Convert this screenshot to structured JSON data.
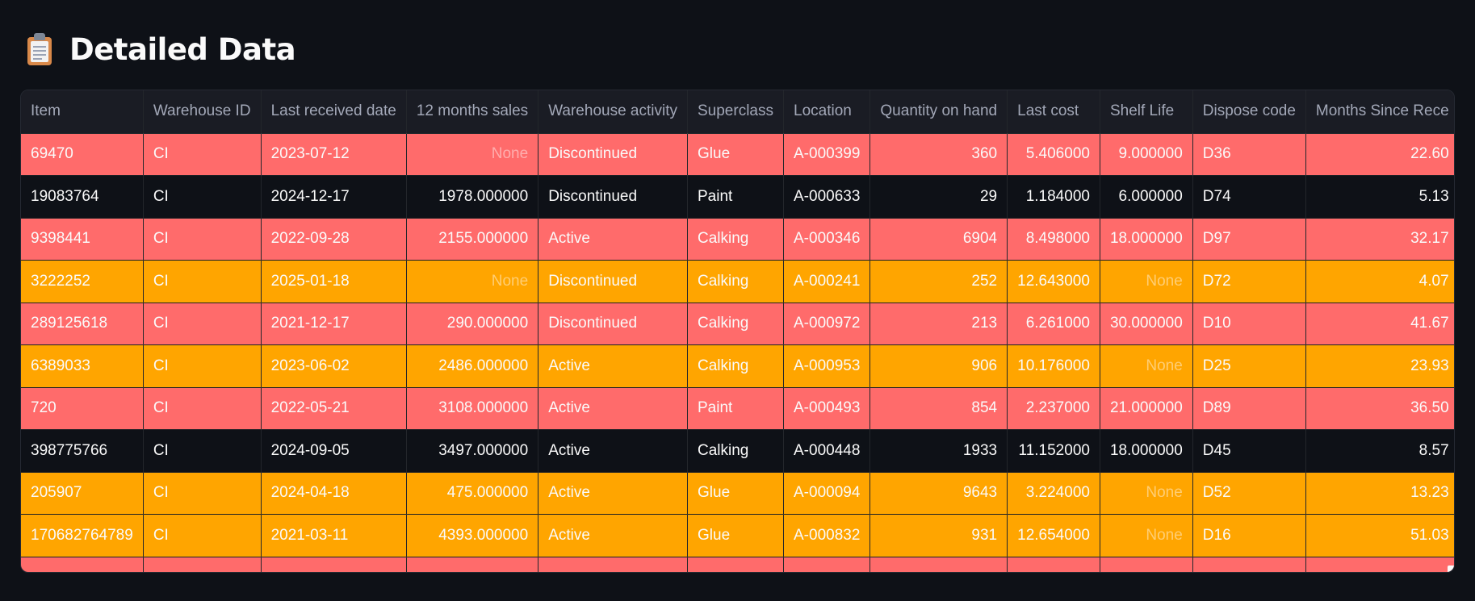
{
  "header": {
    "icon": "clipboard-icon",
    "title": "Detailed Data"
  },
  "table": {
    "columns": [
      "Item",
      "Warehouse ID",
      "Last received date",
      "12 months sales",
      "Warehouse activity",
      "Superclass",
      "Location",
      "Quantity on hand",
      "Last cost",
      "Shelf Life",
      "Dispose code",
      "Months Since Rece"
    ],
    "rows": [
      {
        "tone": "red",
        "cells": [
          "69470",
          "CI",
          "2023-07-12",
          "None",
          "Discontinued",
          "Glue",
          "A-000399",
          "360",
          "5.406000",
          "9.000000",
          "D36",
          "22.60"
        ]
      },
      {
        "tone": "plain",
        "cells": [
          "19083764",
          "CI",
          "2024-12-17",
          "1978.000000",
          "Discontinued",
          "Paint",
          "A-000633",
          "29",
          "1.184000",
          "6.000000",
          "D74",
          "5.13"
        ]
      },
      {
        "tone": "red",
        "cells": [
          "9398441",
          "CI",
          "2022-09-28",
          "2155.000000",
          "Active",
          "Calking",
          "A-000346",
          "6904",
          "8.498000",
          "18.000000",
          "D97",
          "32.17"
        ]
      },
      {
        "tone": "orange",
        "cells": [
          "3222252",
          "CI",
          "2025-01-18",
          "None",
          "Discontinued",
          "Calking",
          "A-000241",
          "252",
          "12.643000",
          "None",
          "D72",
          "4.07"
        ]
      },
      {
        "tone": "red",
        "cells": [
          "289125618",
          "CI",
          "2021-12-17",
          "290.000000",
          "Discontinued",
          "Calking",
          "A-000972",
          "213",
          "6.261000",
          "30.000000",
          "D10",
          "41.67"
        ]
      },
      {
        "tone": "orange",
        "cells": [
          "6389033",
          "CI",
          "2023-06-02",
          "2486.000000",
          "Active",
          "Calking",
          "A-000953",
          "906",
          "10.176000",
          "None",
          "D25",
          "23.93"
        ]
      },
      {
        "tone": "red",
        "cells": [
          "720",
          "CI",
          "2022-05-21",
          "3108.000000",
          "Active",
          "Paint",
          "A-000493",
          "854",
          "2.237000",
          "21.000000",
          "D89",
          "36.50"
        ]
      },
      {
        "tone": "plain",
        "cells": [
          "398775766",
          "CI",
          "2024-09-05",
          "3497.000000",
          "Active",
          "Calking",
          "A-000448",
          "1933",
          "11.152000",
          "18.000000",
          "D45",
          "8.57"
        ]
      },
      {
        "tone": "orange",
        "cells": [
          "205907",
          "CI",
          "2024-04-18",
          "475.000000",
          "Active",
          "Glue",
          "A-000094",
          "9643",
          "3.224000",
          "None",
          "D52",
          "13.23"
        ]
      },
      {
        "tone": "orange",
        "cells": [
          "170682764789",
          "CI",
          "2021-03-11",
          "4393.000000",
          "Active",
          "Glue",
          "A-000832",
          "931",
          "12.654000",
          "None",
          "D16",
          "51.03"
        ]
      }
    ]
  }
}
